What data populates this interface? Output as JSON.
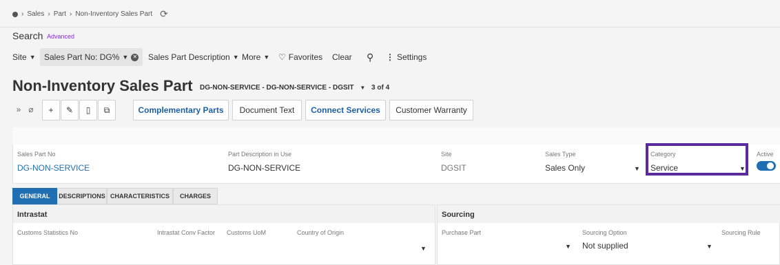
{
  "breadcrumb": {
    "items": [
      "Sales",
      "Part",
      "Non-Inventory Sales Part"
    ]
  },
  "search": {
    "label": "Search",
    "advanced": "Advanced"
  },
  "filters": {
    "site": "Site",
    "sales_part_no": "Sales Part No: DG%",
    "sales_part_desc": "Sales Part Description",
    "more": "More",
    "favorites": "Favorites",
    "clear": "Clear",
    "settings": "Settings"
  },
  "header": {
    "title": "Non-Inventory Sales Part",
    "record": "DG-NON-SERVICE - DG-NON-SERVICE - DGSIT",
    "count": "3 of 4"
  },
  "toolbar": {
    "complementary": "Complementary Parts",
    "document_text": "Document Text",
    "connect_services": "Connect Services",
    "customer_warranty": "Customer Warranty"
  },
  "fields": {
    "sales_part_no": {
      "label": "Sales Part No",
      "value": "DG-NON-SERVICE"
    },
    "part_desc": {
      "label": "Part Description in Use",
      "value": "DG-NON-SERVICE"
    },
    "site": {
      "label": "Site",
      "value": "DGSIT"
    },
    "sales_type": {
      "label": "Sales Type",
      "value": "Sales Only"
    },
    "category": {
      "label": "Category",
      "value": "Service"
    },
    "active": {
      "label": "Active",
      "value": true
    }
  },
  "tabs": [
    "GENERAL",
    "DESCRIPTIONS",
    "CHARACTERISTICS",
    "CHARGES"
  ],
  "intrastat": {
    "title": "Intrastat",
    "customs_stat_no": "Customs Statistics No",
    "conv_factor": "Intrastat Conv Factor",
    "customs_uom": "Customs UoM",
    "country": "Country of Origin"
  },
  "sourcing": {
    "title": "Sourcing",
    "purchase_part": "Purchase Part",
    "sourcing_option_label": "Sourcing Option",
    "sourcing_option_value": "Not supplied",
    "sourcing_rule": "Sourcing Rule"
  },
  "colors": {
    "accent": "#1f6fb2",
    "highlight": "#5b2a9e"
  }
}
